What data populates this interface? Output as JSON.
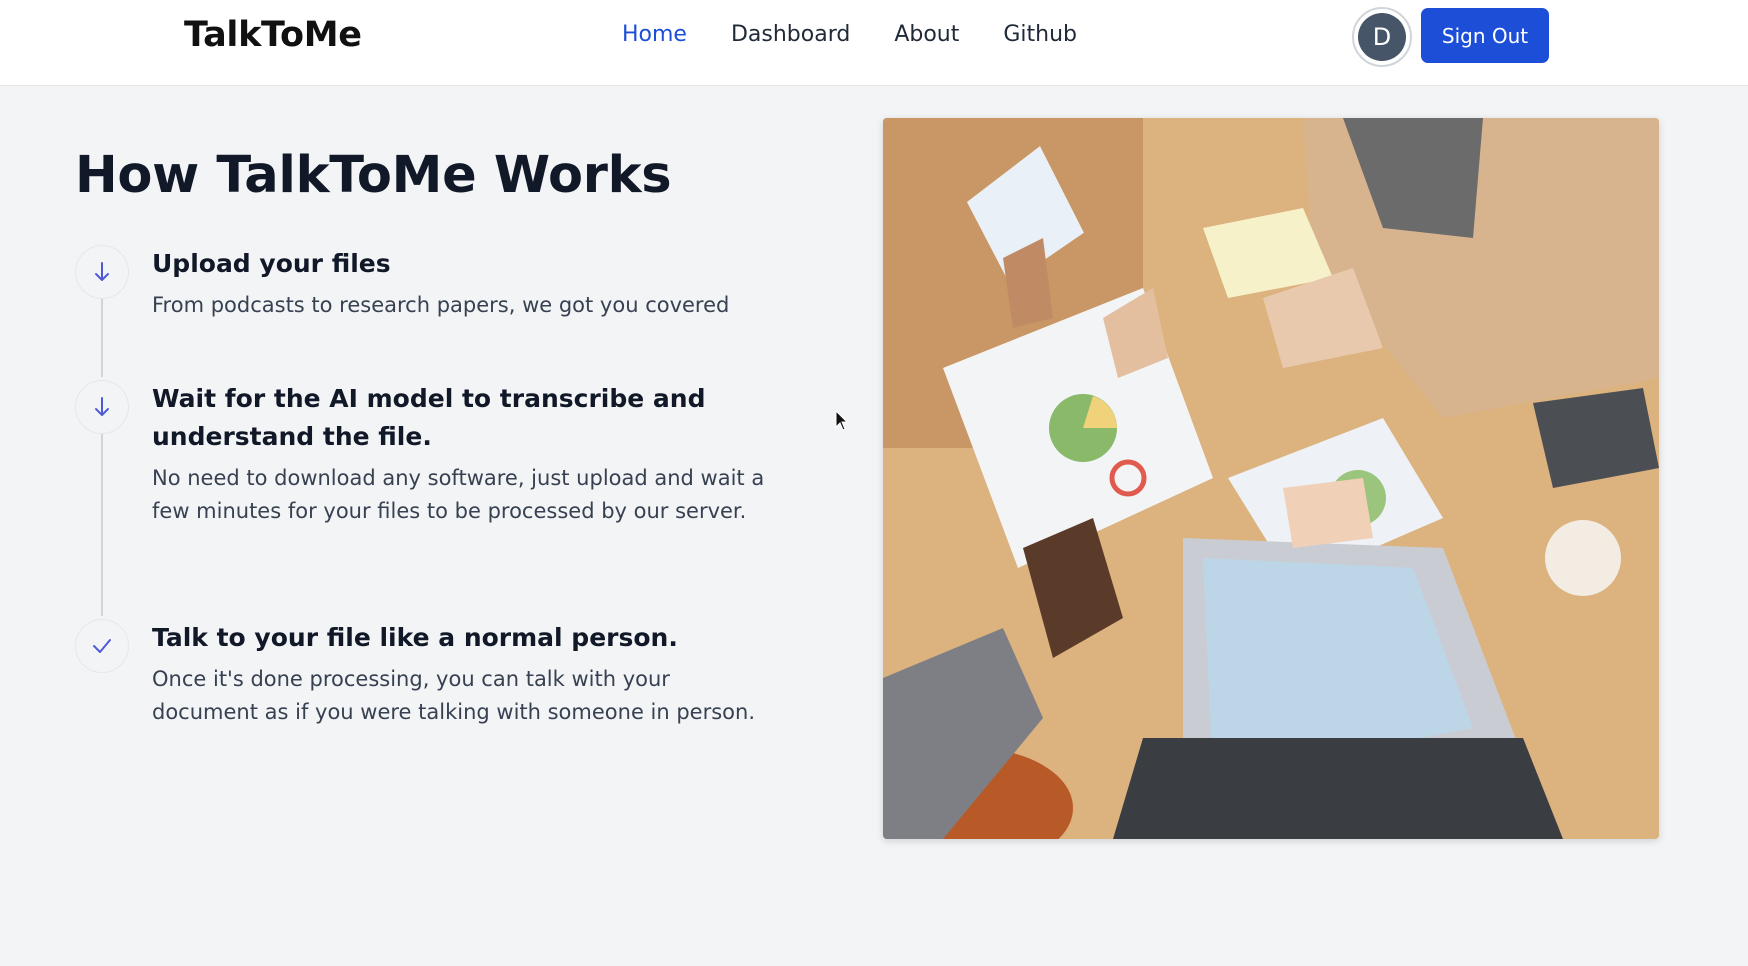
{
  "header": {
    "logo": "TalkToMe",
    "nav": [
      {
        "label": "Home",
        "active": true
      },
      {
        "label": "Dashboard",
        "active": false
      },
      {
        "label": "About",
        "active": false
      },
      {
        "label": "Github",
        "active": false
      }
    ],
    "avatar_initial": "D",
    "sign_out_label": "Sign Out"
  },
  "main": {
    "title": "How TalkToMe Works",
    "steps": [
      {
        "icon": "arrow-down-icon",
        "title": "Upload your files",
        "description": "From podcasts to research papers, we got you covered"
      },
      {
        "icon": "arrow-down-icon",
        "title": "Wait for the AI model to transcribe and understand the file.",
        "description": "No need to download any software, just upload and wait a few minutes for your files to be processed by our server."
      },
      {
        "icon": "check-icon",
        "title": "Talk to your file like a normal person.",
        "description": "Once it's done processing, you can talk with your document as if you were talking with someone in person."
      }
    ]
  },
  "colors": {
    "accent": "#1d4ed8",
    "background": "#f3f4f6",
    "step_icon": "#4f5bd5"
  }
}
